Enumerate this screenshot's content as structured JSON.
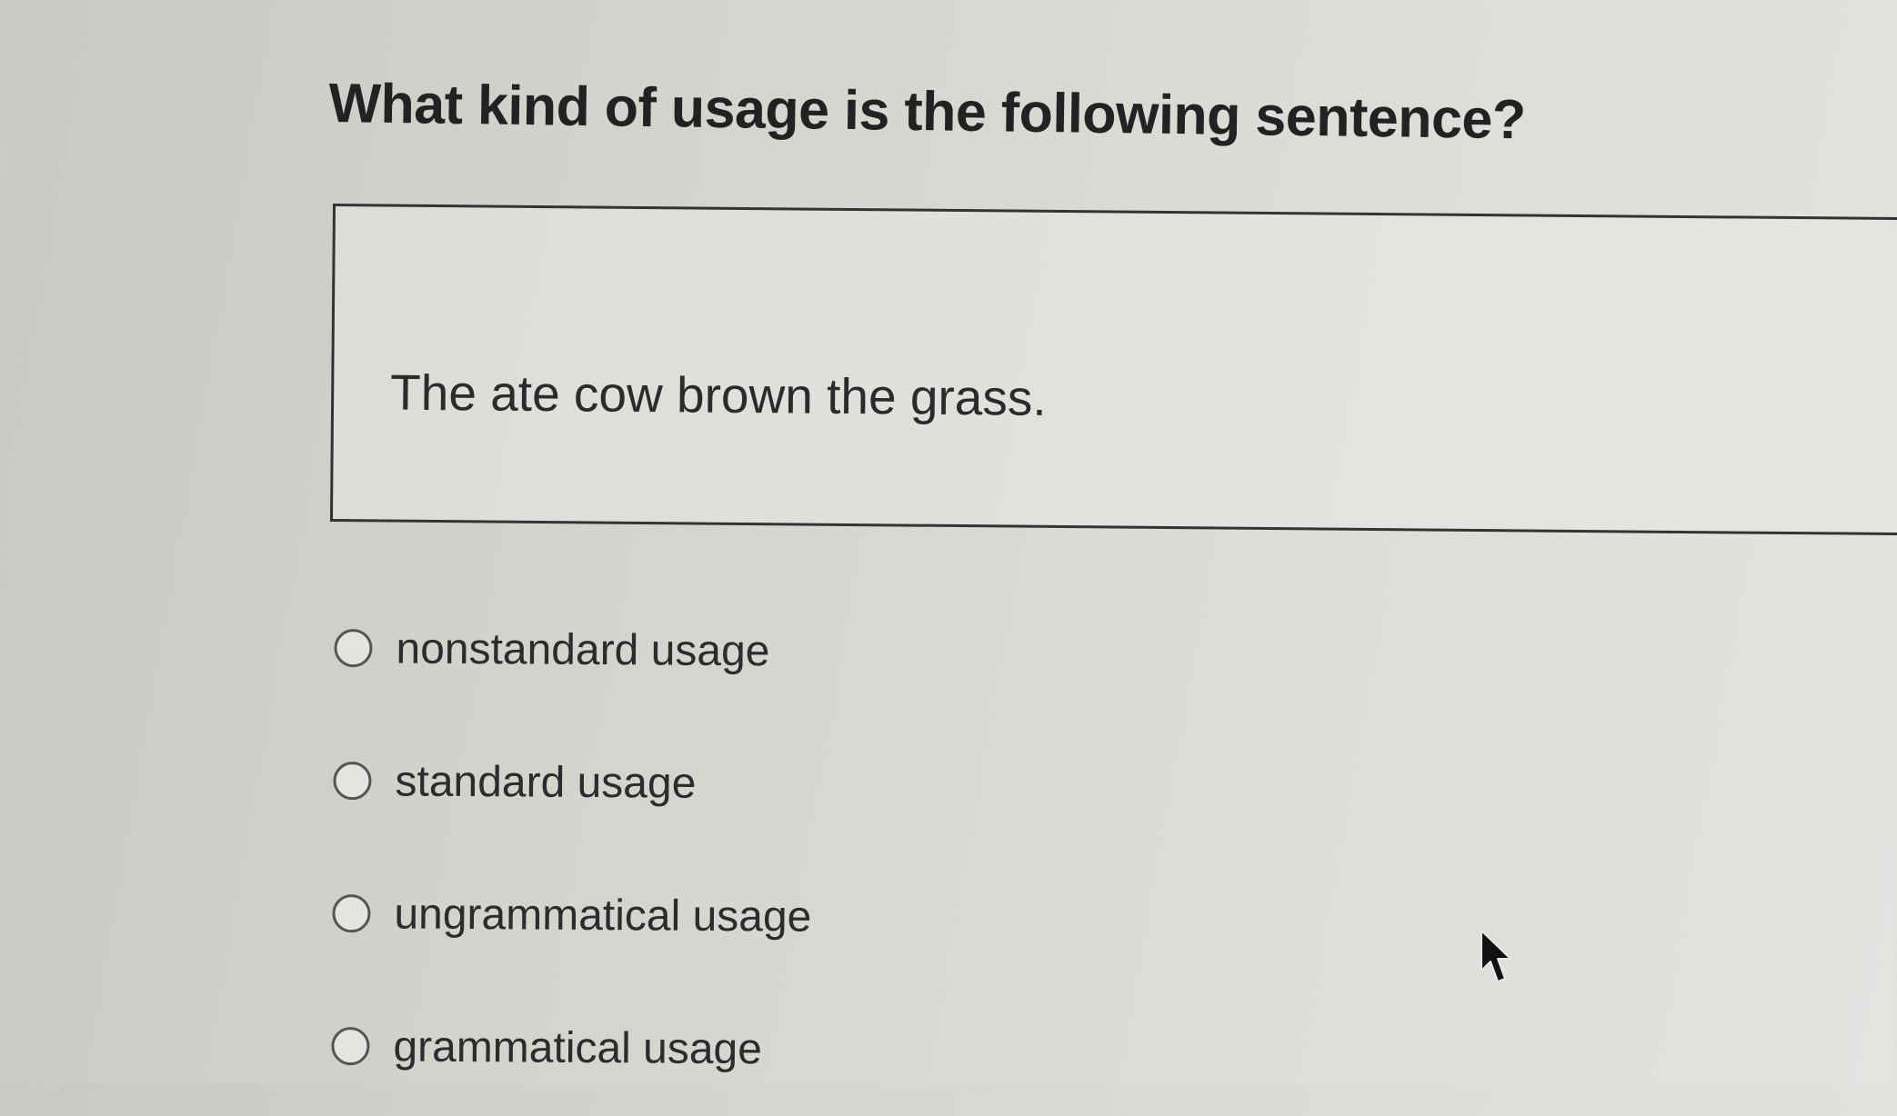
{
  "question": {
    "title": "What kind of usage is the following sentence?"
  },
  "passage": {
    "text": "The ate cow brown the grass."
  },
  "options": [
    {
      "label": "nonstandard usage",
      "selected": false
    },
    {
      "label": "standard usage",
      "selected": false
    },
    {
      "label": "ungrammatical usage",
      "selected": false
    },
    {
      "label": "grammatical usage",
      "selected": false
    }
  ],
  "pointer": {
    "icon": "mouse-pointer-icon"
  }
}
